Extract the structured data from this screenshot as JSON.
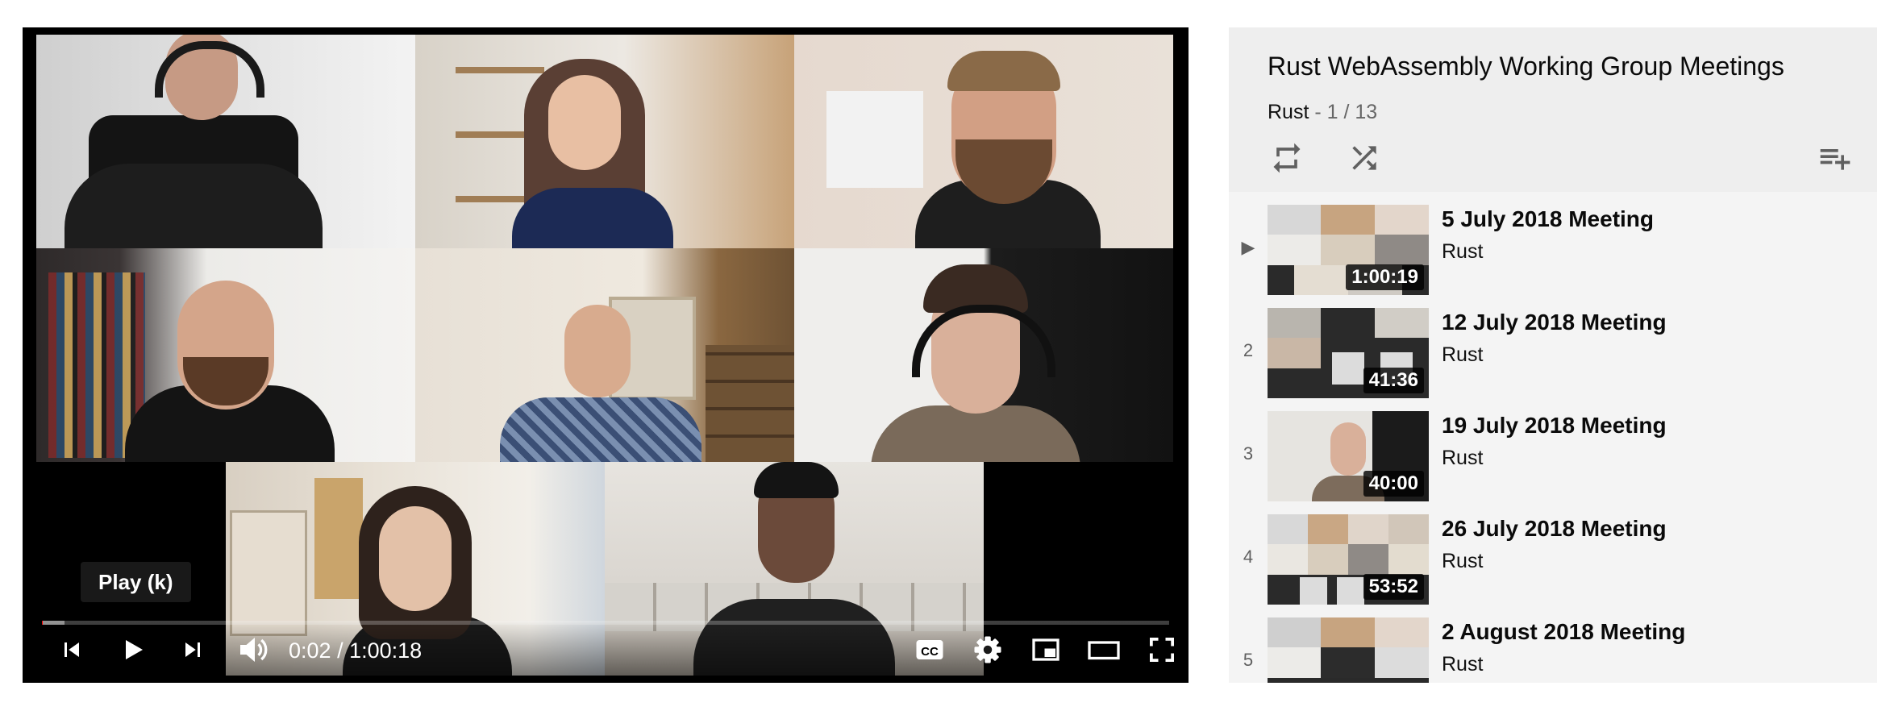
{
  "player": {
    "tooltip": "Play (k)",
    "current_time": "0:02",
    "duration": "1:00:18",
    "time_separator": " / ",
    "progress_played_fraction": 0.0006,
    "progress_loaded_fraction": 0.02,
    "controls": [
      "previous-icon",
      "play-icon",
      "next-icon",
      "volume-icon",
      "subtitles-icon",
      "settings-icon",
      "miniplayer-icon",
      "theater-mode-icon",
      "fullscreen-icon"
    ],
    "colors": {
      "progress": "#ff0000",
      "controls": "#ffffff"
    }
  },
  "playlist": {
    "title": "Rust WebAssembly Working Group Meetings",
    "channel": "Rust",
    "separator": " - ",
    "position": "1 / 13",
    "actions": [
      "loop-icon",
      "shuffle-icon",
      "save-to-playlist-icon"
    ],
    "items": [
      {
        "index": "▶",
        "title": "5 July 2018 Meeting",
        "channel": "Rust",
        "duration": "1:00:19",
        "now_playing": true
      },
      {
        "index": "2",
        "title": "12 July 2018 Meeting",
        "channel": "Rust",
        "duration": "41:36"
      },
      {
        "index": "3",
        "title": "19 July 2018 Meeting",
        "channel": "Rust",
        "duration": "40:00"
      },
      {
        "index": "4",
        "title": "26 July 2018 Meeting",
        "channel": "Rust",
        "duration": "53:52"
      },
      {
        "index": "5",
        "title": "2 August 2018 Meeting",
        "channel": "Rust",
        "duration": ""
      }
    ]
  }
}
